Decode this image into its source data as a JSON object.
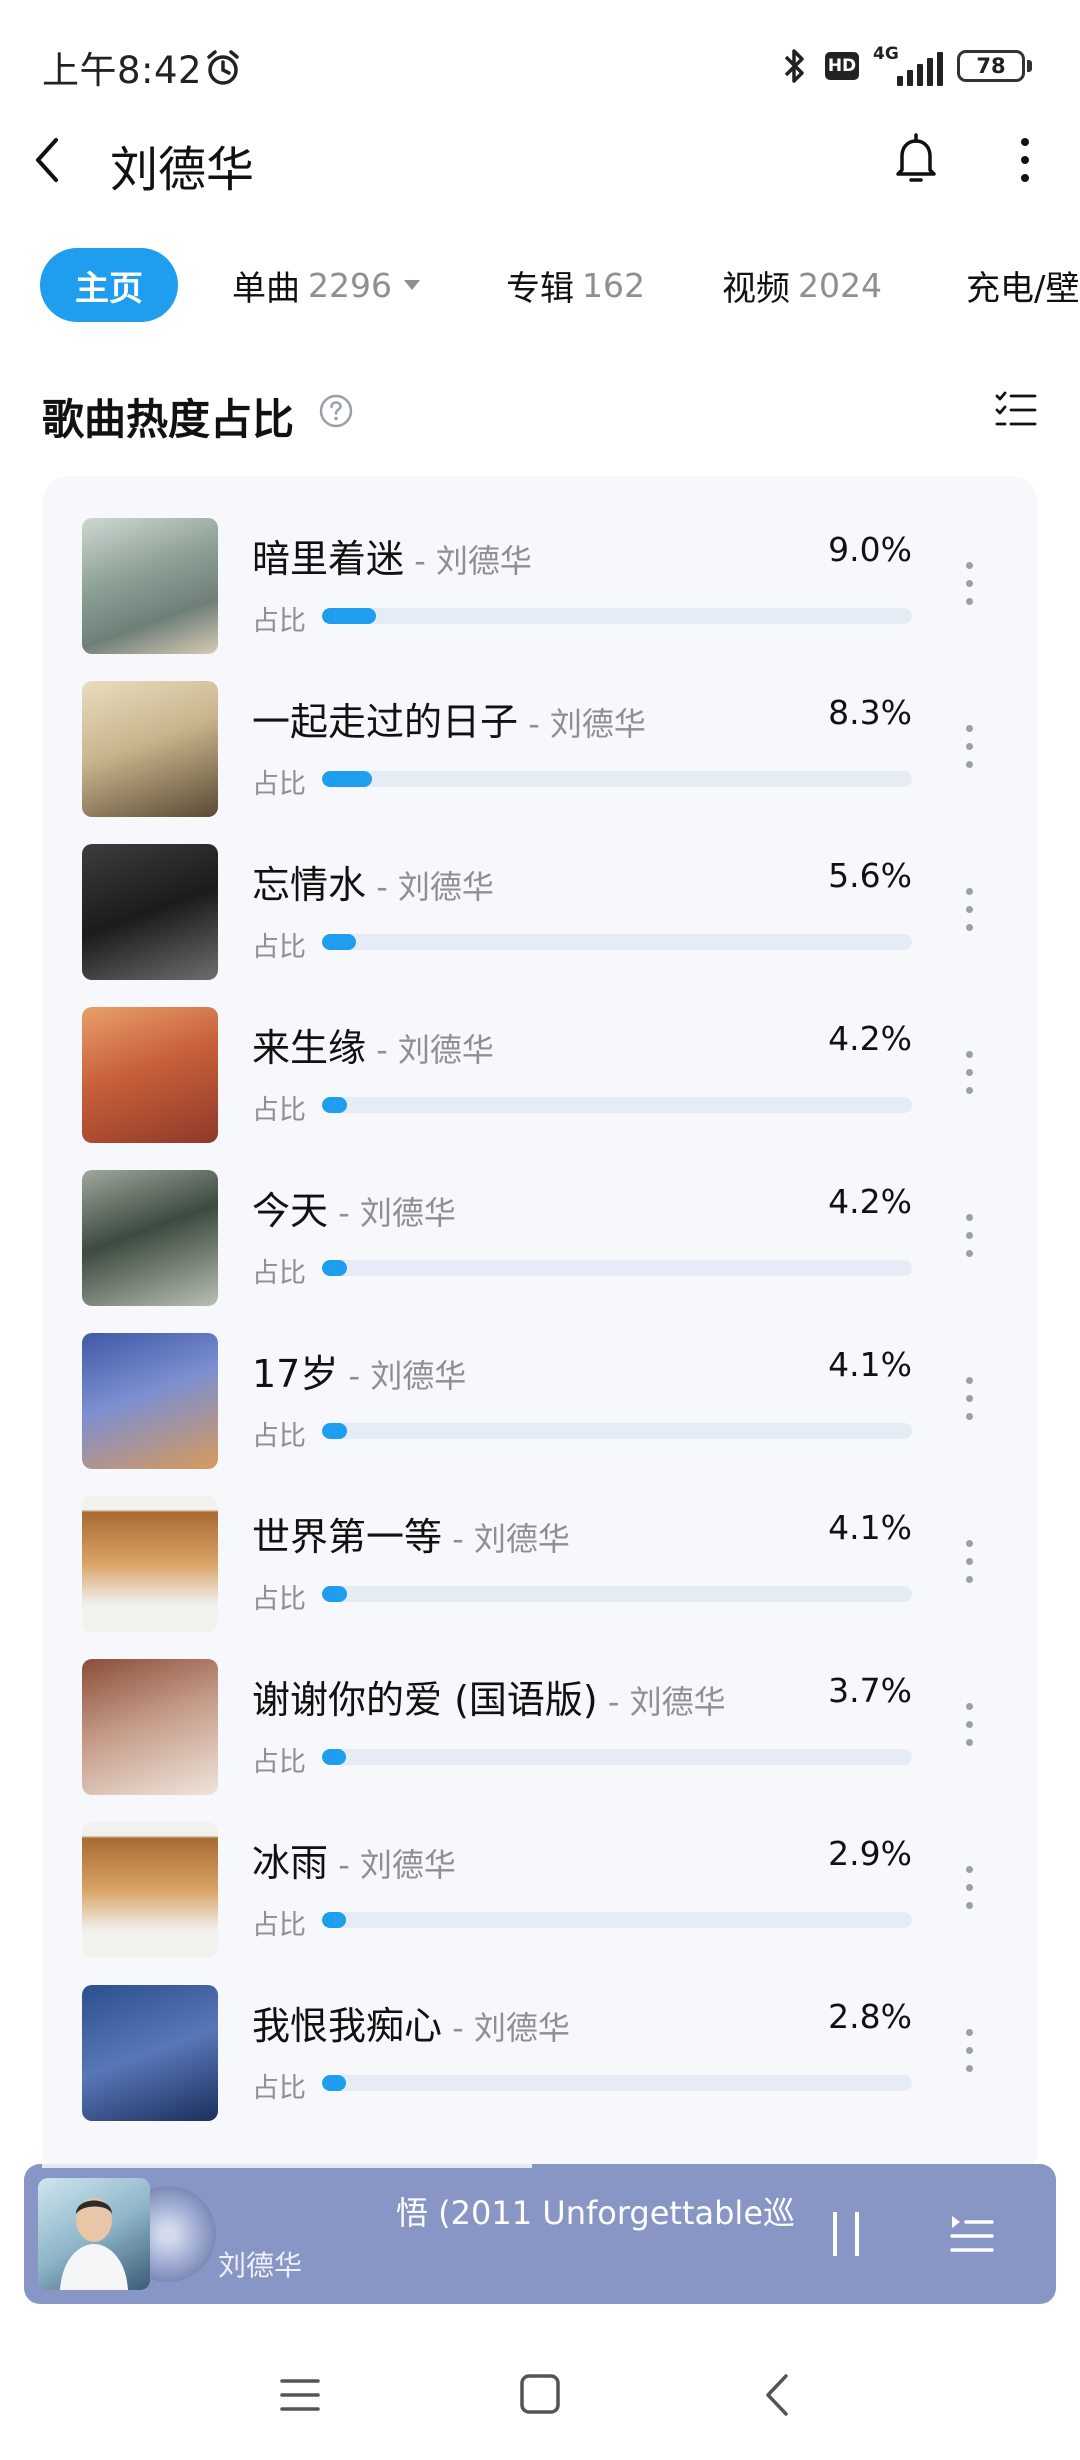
{
  "status": {
    "time": "上午8:42",
    "network": "4G",
    "hd": "HD",
    "battery": "78"
  },
  "header": {
    "title": "刘德华"
  },
  "tabs": [
    {
      "label": "主页",
      "count": ""
    },
    {
      "label": "单曲",
      "count": "2296"
    },
    {
      "label": "专辑",
      "count": "162"
    },
    {
      "label": "视频",
      "count": "2024"
    },
    {
      "label": "充电/壁",
      "count": ""
    }
  ],
  "section": {
    "title": "歌曲热度占比"
  },
  "songs": [
    {
      "title": "暗里着迷",
      "artist": " - 刘德华",
      "percent": "9.0%",
      "ratio_label": "占比",
      "share": 0.09
    },
    {
      "title": "一起走过的日子",
      "artist": " - 刘德华",
      "percent": "8.3%",
      "ratio_label": "占比",
      "share": 0.083
    },
    {
      "title": "忘情水",
      "artist": " - 刘德华",
      "percent": "5.6%",
      "ratio_label": "占比",
      "share": 0.056
    },
    {
      "title": "来生缘",
      "artist": " - 刘德华",
      "percent": "4.2%",
      "ratio_label": "占比",
      "share": 0.042
    },
    {
      "title": "今天",
      "artist": " - 刘德华",
      "percent": "4.2%",
      "ratio_label": "占比",
      "share": 0.042
    },
    {
      "title": "17岁",
      "artist": " - 刘德华",
      "percent": "4.1%",
      "ratio_label": "占比",
      "share": 0.041
    },
    {
      "title": "世界第一等",
      "artist": " - 刘德华",
      "percent": "4.1%",
      "ratio_label": "占比",
      "share": 0.041
    },
    {
      "title": "谢谢你的爱 (国语版)",
      "artist": " - 刘德华",
      "percent": "3.7%",
      "ratio_label": "占比",
      "share": 0.037
    },
    {
      "title": "冰雨",
      "artist": " - 刘德华",
      "percent": "2.9%",
      "ratio_label": "占比",
      "share": 0.029
    },
    {
      "title": "我恨我痴心",
      "artist": " - 刘德华",
      "percent": "2.8%",
      "ratio_label": "占比",
      "share": 0.028
    }
  ],
  "player": {
    "title": "悟 (2011 Unforgettable巡",
    "artist": "刘德华"
  },
  "colors": {
    "accent": "#1f9dee",
    "track": "#e6ecf5",
    "card_bg": "#f6f8fc",
    "player_bg": "#8896c6",
    "muted": "#8e8e93"
  }
}
